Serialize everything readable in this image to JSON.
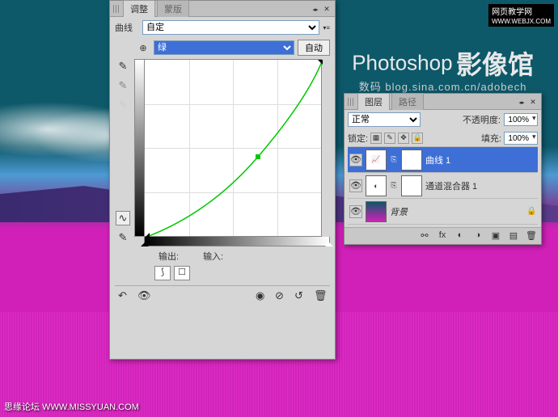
{
  "watermarks": {
    "top_right": "网页教学网",
    "top_right_url": "WWW.WEBJX.COM",
    "title_en": "Photoshop",
    "title_cn": "影像馆",
    "title_sub_prefix": "数码",
    "blog_url": "blog.sina.com.cn/adobech",
    "bottom_left": "思缘论坛  WWW.MISSYUAN.COM"
  },
  "curves": {
    "tabs": {
      "active": "调整",
      "inactive": "蒙版"
    },
    "preset_label": "曲线",
    "preset_value": "自定",
    "channel_value": "绿",
    "auto_btn": "自动",
    "output_label": "输出:",
    "input_label": "输入:",
    "points": [
      {
        "x": 0,
        "y": 220
      },
      {
        "x": 140,
        "y": 120
      },
      {
        "x": 220,
        "y": 0
      }
    ],
    "tools": {
      "target": "⊕",
      "eyedrop_black": "✎",
      "eyedrop_gray": "✎",
      "eyedrop_white": "✎",
      "curve_mode": "∿",
      "pencil_mode": "✎"
    },
    "footer": {
      "reset": "↶",
      "visibility": "👁",
      "prev": "◉",
      "clip": "⊘",
      "trash": "🗑"
    }
  },
  "layers": {
    "tabs": {
      "active": "图层",
      "inactive": "路径"
    },
    "blend_label": "",
    "blend_value": "正常",
    "opacity_label": "不透明度:",
    "opacity_value": "100%",
    "lock_label": "锁定:",
    "fill_label": "填充:",
    "fill_value": "100%",
    "items": [
      {
        "name": "曲线 1",
        "type": "curves",
        "selected": true,
        "mask": true,
        "visible": true
      },
      {
        "name": "通道混合器 1",
        "type": "mixer",
        "selected": false,
        "mask": true,
        "visible": true
      },
      {
        "name": "背景",
        "type": "background",
        "selected": false,
        "mask": false,
        "visible": true,
        "locked": true
      }
    ],
    "footer": {
      "link": "⚯",
      "fx": "fx",
      "mask": "◐",
      "adjust": "◑",
      "group": "▣",
      "new": "▤",
      "trash": "🗑"
    }
  },
  "chart_data": {
    "type": "line",
    "title": "Curves Adjustment (Green Channel)",
    "xlabel": "输入",
    "ylabel": "输出",
    "xlim": [
      0,
      255
    ],
    "ylim": [
      0,
      255
    ],
    "series": [
      {
        "name": "绿",
        "color": "#00c800",
        "points_est": [
          [
            0,
            0
          ],
          [
            64,
            40
          ],
          [
            128,
            110
          ],
          [
            163,
            140
          ],
          [
            192,
            180
          ],
          [
            224,
            220
          ],
          [
            255,
            255
          ]
        ]
      }
    ]
  }
}
